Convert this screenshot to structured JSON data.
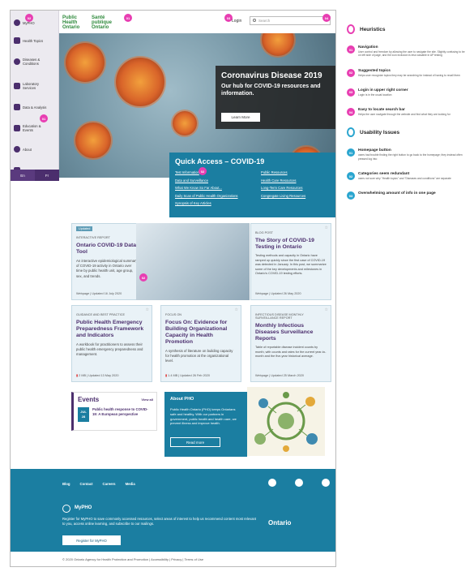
{
  "sidebar": {
    "items": [
      {
        "label": "MyPHO",
        "icon": "user-icon"
      },
      {
        "label": "Health Topics",
        "icon": "book-icon"
      },
      {
        "label": "Diseases & Conditions",
        "icon": "virus-icon"
      },
      {
        "label": "Laboratory Services",
        "icon": "flask-icon"
      },
      {
        "label": "Data & Analysis",
        "icon": "chart-icon"
      },
      {
        "label": "Education & Events",
        "icon": "graduation-icon"
      },
      {
        "label": "About",
        "icon": "info-icon"
      },
      {
        "label": "Contact",
        "icon": "mail-icon"
      }
    ],
    "lang": [
      "En",
      "Fr"
    ]
  },
  "header": {
    "logo_en": "Public Health Ontario",
    "logo_fr": "Santé publique Ontario",
    "login": "Login",
    "search_placeholder": "Search"
  },
  "hero": {
    "title": "Coronavirus Disease 2019",
    "subtitle": "Our hub for COVID-19 resources and information.",
    "button": "Learn More"
  },
  "quick_access": {
    "title": "Quick Access – COVID-19",
    "left": [
      "Test Information",
      "Data and Surveillance",
      "What We Know So Far About...",
      "Daily Scan of Public Health Organizations",
      "Synopsis of Key Articles"
    ],
    "right": [
      "Public Resources",
      "Health Care Resources",
      "Long-Term Care Resources",
      "Congregate Living Resources"
    ]
  },
  "cards": [
    {
      "badge": "Updated",
      "tag": "Interactive Report",
      "title": "Ontario COVID-19 Data Tool",
      "desc": "An interactive epidemiological summary of COVID-19 activity in Ontario over time by public health unit, age group, sex, and trends.",
      "meta": "Webpage | Updated 16 July 2020"
    },
    {
      "tag": "Blog Post",
      "title": "The Story of COVID-19 Testing in Ontario",
      "desc": "Testing methods and capacity in Ontario have ramped up quickly since the first case of COVID-19 was detected in January. In this post, we summarize some of the key developments and milestones in Ontario's COVID-19 testing efforts.",
      "meta": "Webpage | Updated 26 May 2020"
    },
    {
      "tag": "Guidance and Best Practice",
      "title": "Public Health Emergency Preparedness Framework and Indicators",
      "desc": "A workbook for practitioners to assess their public health emergency preparedness and management.",
      "meta": "2 MB | Updated 13 May 2020"
    },
    {
      "tag": "Focus On",
      "title": "Focus On: Evidence for Building Organizational Capacity in Health Promotion",
      "desc": "A synthesis of literature on building capacity for health promotion at the organizational level.",
      "meta": "1.4 MB | Updated 26 Feb 2020"
    },
    {
      "tag": "Infectious Disease Monthly Surveillance Report",
      "title": "Monthly Infectious Diseases Surveillance Reports",
      "desc": "Table of reportable disease incident counts by month, with counts and rates for the current year-to-month and the five-year historical average.",
      "meta": "Webpage | Updated 25 March 2020"
    }
  ],
  "events": {
    "title": "Events",
    "view_all": "View all",
    "month": "JUL",
    "day": "28",
    "item": "Public health response to COVID-19: A European perspective"
  },
  "about": {
    "title": "About PHO",
    "text": "Public Health Ontario (PHO) keeps Ontarians safe and healthy. With our partners in government, public health and health care, we prevent illness and improve health.",
    "button": "Read more"
  },
  "footer": {
    "nav": [
      "Blog",
      "Contact",
      "Careers",
      "Media"
    ],
    "social": [
      "facebook-icon",
      "linkedin-icon",
      "youtube-icon",
      "twitter-icon"
    ],
    "mypho_title": "MyPHO",
    "mypho_text": "Register for MyPHO to save commonly accessed resources, select areas of interest to help us recommend content most relevant to you, access online learning, and subscribe to our mailings.",
    "register": "Register for MyPHO",
    "ontario": "Ontario",
    "legal": "© 2020 Ontario Agency for Health Protection and Promotion | Accessibility | Privacy | Terms of Use"
  },
  "pins": [
    "01",
    "02",
    "03",
    "04",
    "01",
    "02",
    "02"
  ],
  "annotations": {
    "heuristics_title": "Heuristics",
    "heuristics": [
      {
        "n": "01",
        "title": "Navigation",
        "desc": "User control and freedom by allowing the user to navigate the site. Slightly confusing to be on left side of page, and the icon inclusion is less valuable in AP testing"
      },
      {
        "n": "02",
        "title": "Suggested topics",
        "desc": "Helps user recognize topics they may be searching for instead of having to recall them"
      },
      {
        "n": "03",
        "title": "Login in upper right corner",
        "desc": "Login is in the usual location"
      },
      {
        "n": "04",
        "title": "Easy to locate search bar",
        "desc": "Helps the user navigate through the website and find what they are looking for"
      }
    ],
    "issues_title": "Usability Issues",
    "issues": [
      {
        "n": "01",
        "title": "Homepage button",
        "desc": "users had trouble finding the right button to go back to the homepage; they instead often pressed log into"
      },
      {
        "n": "02",
        "title": "Categories seem redundant",
        "desc": "users not sure why \"Health topics\" and \"Diseases and conditions\" are separate"
      },
      {
        "n": "03",
        "title": "Overwhelming amount of info in one page",
        "desc": ""
      }
    ]
  },
  "colors": {
    "purple": "#4b2e6d",
    "teal": "#1b7ea1",
    "pink": "#e83eb2",
    "blue_pin": "#2aa5cf",
    "green": "#2f8a3c"
  }
}
